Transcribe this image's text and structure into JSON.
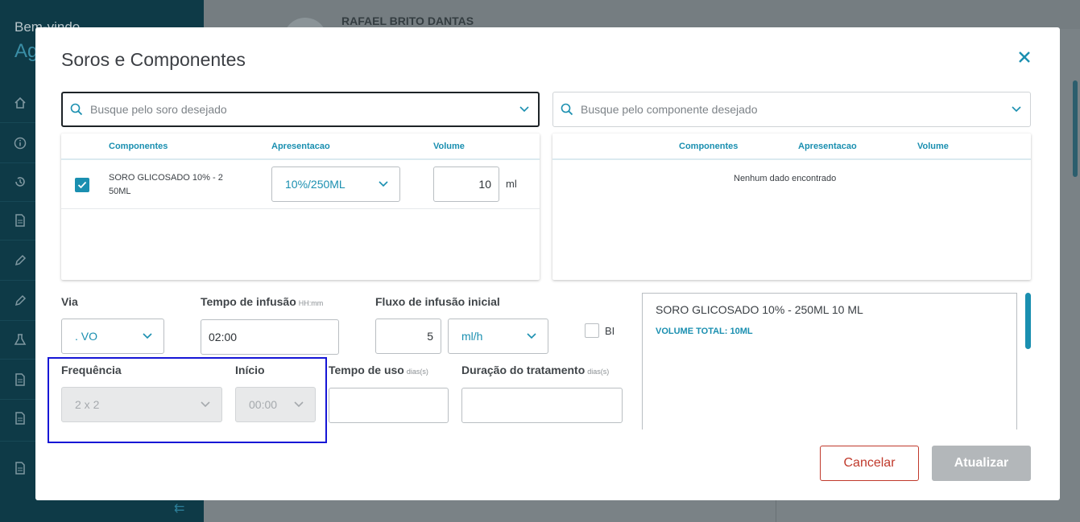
{
  "background": {
    "welcome": "Bem-vindo",
    "brand": "Ag",
    "patient_name": "RAFAEL BRITO DANTAS"
  },
  "modal": {
    "title": "Soros e Componentes",
    "close_icon": "close-icon"
  },
  "soro_search": {
    "placeholder": "Busque pelo soro desejado"
  },
  "componente_search": {
    "placeholder": "Busque pelo componente desejado"
  },
  "soro_table": {
    "headers": [
      "Componentes",
      "Apresentacao",
      "Volume"
    ],
    "rows": [
      {
        "checked": true,
        "componente": "SORO GLICOSADO 10% - 2 50ML",
        "apresentacao": "10%/250ML",
        "volume": "10",
        "unit": "ml"
      }
    ]
  },
  "componente_table": {
    "headers": [
      "Componentes",
      "Apresentacao",
      "Volume"
    ],
    "empty_message": "Nenhum dado encontrado"
  },
  "form": {
    "via": {
      "label": "Via",
      "value": ". VO"
    },
    "tempo_infusao": {
      "label": "Tempo de infusão",
      "hint": "HH:mm",
      "value": "02:00"
    },
    "fluxo_infusao": {
      "label": "Fluxo de infusão inicial",
      "value": "5",
      "unit": "ml/h"
    },
    "bi": {
      "label": "BI",
      "checked": false
    },
    "frequencia": {
      "label": "Frequência",
      "value": "2 x 2"
    },
    "inicio": {
      "label": "Início",
      "value": "00:00"
    },
    "tempo_uso": {
      "label": "Tempo de uso",
      "hint": "dias(s)",
      "value": ""
    },
    "duracao": {
      "label": "Duração do tratamento",
      "hint": "dias(s)",
      "value": ""
    }
  },
  "summary": {
    "line": "SORO GLICOSADO 10% - 250ML 10 ML",
    "total": "VOLUME TOTAL: 10ML"
  },
  "buttons": {
    "cancel": "Cancelar",
    "update": "Atualizar"
  },
  "colors": {
    "accent": "#1a8fb0",
    "danger": "#c0392b",
    "disabled": "#b3b7ba"
  }
}
